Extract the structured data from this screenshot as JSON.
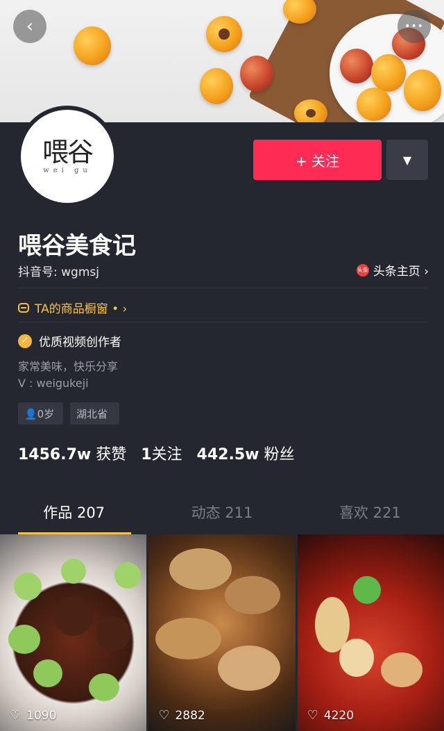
{
  "header": {
    "back_icon": "chevron-left-icon",
    "more_icon": "more-dots-icon",
    "back_glyph": "‹",
    "more_glyph": "•••"
  },
  "profile": {
    "avatar_text_main": "喂谷",
    "avatar_text_sub": "wei gu",
    "follow_label": "+ 关注",
    "dropdown_glyph": "▼",
    "name": "喂谷美食记",
    "douyin_id": "抖音号: wgmsj",
    "toutiao_badge": "头条",
    "toutiao_label": "头条主页 ›",
    "shop_label": "TA的商品橱窗 • ›",
    "verified_label": "优质视频创作者",
    "verified_check": "✓",
    "bio": [
      "家常美味，快乐分享",
      "V : weigukeji"
    ],
    "tags": [
      "👤0岁",
      "湖北省"
    ],
    "stats": {
      "likes_value": "1456.7w",
      "likes_label": "获赞",
      "following_value": "1",
      "following_label": "关注",
      "fans_value": "442.5w",
      "fans_label": "粉丝"
    }
  },
  "tabs": [
    {
      "label": "作品 207",
      "active": true
    },
    {
      "label": "动态 211",
      "active": false
    },
    {
      "label": "喜欢 221",
      "active": false
    }
  ],
  "videos": [
    {
      "likes": "1090"
    },
    {
      "likes": "2882"
    },
    {
      "likes": "4220"
    }
  ],
  "colors": {
    "accent": "#fe2c55",
    "highlight": "#f6c244",
    "background": "#252730"
  }
}
